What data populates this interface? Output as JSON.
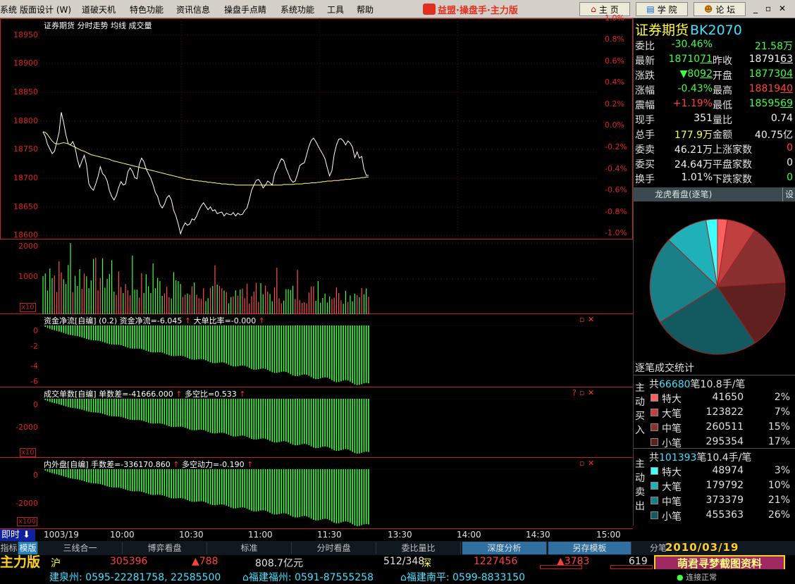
{
  "menu": {
    "items": [
      "系统",
      "版面设计 (W)",
      "道破天机",
      "特色功能",
      "资讯信息",
      "操盘手点睛",
      "系统功能",
      "工具",
      "帮助"
    ],
    "brand": "益盟·操盘手·主力版",
    "buttons": [
      "主 页",
      "学 院",
      "论 坛"
    ],
    "window_controls": [
      "_",
      "▫",
      "✕"
    ]
  },
  "price_chart": {
    "title": "证券期货  分时走势 均线 成交量",
    "left_ticks": [
      "18950",
      "18900",
      "18850",
      "18800",
      "18750",
      "18700",
      "18650",
      "18600"
    ],
    "right_ticks": [
      "1.0%",
      "0.8%",
      "0.6%",
      "0.4%",
      "0.2%",
      "0.0%",
      "-0.2%",
      "-0.4%",
      "-0.6%",
      "-0.8%",
      "-1.0%"
    ],
    "ylim": [
      18593,
      18979
    ],
    "prev_close": 18791.63,
    "price": [
      18781,
      18773,
      18759,
      18751,
      18743,
      18747,
      18763,
      18780,
      18815,
      18797,
      18776,
      18760,
      18758,
      18764,
      18754,
      18733,
      18719,
      18730,
      18740,
      18723,
      18690,
      18683,
      18679,
      18690,
      18703,
      18720,
      18708,
      18704,
      18695,
      18678,
      18668,
      18662,
      18670,
      18684,
      18694,
      18688,
      18690,
      18711,
      18718,
      18712,
      18701,
      18699,
      18724,
      18735,
      18729,
      18716,
      18708,
      18700,
      18689,
      18675,
      18668,
      18654,
      18648,
      18655,
      18666,
      18670,
      18662,
      18644,
      18634,
      18620,
      18603,
      18614,
      18622,
      18618,
      18620,
      18629,
      18627,
      18634,
      18644,
      18652,
      18657,
      18651,
      18645,
      18650,
      18643,
      18645,
      18638,
      18640,
      18641,
      18634,
      18639,
      18637,
      18636,
      18640,
      18634,
      18639,
      18636,
      18637,
      18644,
      18648,
      18663,
      18679,
      18688,
      18696,
      18698,
      18692,
      18683,
      18688,
      18695,
      18692,
      18688,
      18708,
      18716,
      18726,
      18734,
      18731,
      18718,
      18708,
      18698,
      18693,
      18695,
      18707,
      18722,
      18725,
      18727,
      18741,
      18756,
      18766,
      18770,
      18764,
      18756,
      18749,
      18742,
      18734,
      18718,
      18704,
      18713,
      18741,
      18758,
      18768,
      18769,
      18765,
      18758,
      18765,
      18761,
      18754,
      18736,
      18746,
      18735,
      18738,
      18716,
      18705,
      18705
    ],
    "avg": [
      18781,
      18780,
      18776,
      18770,
      18765,
      18761,
      18760,
      18760,
      18761,
      18762,
      18761,
      18760,
      18758,
      18756,
      18754,
      18752,
      18750,
      18748,
      18747,
      18745,
      18743,
      18741,
      18740,
      18739,
      18738,
      18737,
      18736,
      18735,
      18734,
      18733,
      18731,
      18730,
      18729,
      18728,
      18727,
      18726,
      18725,
      18724,
      18723,
      18722,
      18721,
      18720,
      18719,
      18718,
      18717,
      18716,
      18715,
      18714,
      18713,
      18712,
      18711,
      18710,
      18709,
      18708,
      18707,
      18706,
      18705,
      18704,
      18703,
      18702,
      18701,
      18700,
      18699,
      18698,
      18698,
      18697,
      18696,
      18696,
      18695,
      18695,
      18694,
      18694,
      18693,
      18693,
      18692,
      18692,
      18691,
      18691,
      18690,
      18690,
      18690,
      18689,
      18689,
      18689,
      18688,
      18688,
      18688,
      18688,
      18688,
      18688,
      18688,
      18688,
      18688,
      18688,
      18688,
      18688,
      18688,
      18688,
      18688,
      18688,
      18688,
      18688,
      18688,
      18688,
      18688,
      18689,
      18689,
      18689,
      18689,
      18689,
      18690,
      18690,
      18690,
      18690,
      18691,
      18691,
      18691,
      18692,
      18692,
      18692,
      18693,
      18693,
      18694,
      18694,
      18695,
      18695,
      18695,
      18696,
      18696,
      18696,
      18697,
      18697,
      18698,
      18698,
      18698,
      18699,
      18699,
      18700,
      18700,
      18701,
      18701,
      18702,
      18702
    ]
  },
  "volume": {
    "ticks": [
      "2000",
      "1000"
    ],
    "badge": "x10",
    "max": 2100
  },
  "money_flow": {
    "title_main": "资金净流[自编]",
    "title_param": "(0.2)",
    "title_val": "资金净流=-6.045",
    "title_ratio": "大单比率=-0.000",
    "ticks": [
      "0",
      "-2",
      "-4",
      "-6"
    ],
    "min": -6.3,
    "final": -6.045
  },
  "order_count": {
    "title_main": "成交单数[自编]",
    "title_val": "单数差=-41666.000",
    "title_ratio": "多空比=0.533",
    "ticks": [
      "0",
      "-2000"
    ],
    "badge": "x10",
    "min": -4500,
    "final": -4166.6
  },
  "inner_outer": {
    "title_main": "内外盘[自编]",
    "title_val": "手数差=-336170.860",
    "title_ratio": "多空动力=-0.190",
    "ticks": [
      "0",
      "-2000"
    ],
    "badge": "x100",
    "min": -3500,
    "final": -3361.7
  },
  "time_axis": {
    "labels": [
      "1003/19",
      "10:00",
      "10:30",
      "11:00",
      "11:30",
      "13:30",
      "14:00",
      "14:30",
      "15:00"
    ],
    "instant": "即时"
  },
  "side": {
    "title": "证券期货",
    "code": "BK2070",
    "rows": [
      {
        "l": "委比",
        "v": "-30.46%",
        "vc": "green",
        "l2": "",
        "v2": "21.58万",
        "v2c": "green"
      },
      {
        "l": "最新",
        "v": "18710",
        "vd": "71",
        "vc": "green",
        "l2": "昨收",
        "v2": "18791",
        "v2d": "63",
        "v2c": "white"
      },
      {
        "l": "涨跌",
        "v": "▼80",
        "vd": "92",
        "vc": "green",
        "l2": "开盘",
        "v2": "18773",
        "v2d": "04",
        "v2c": "green"
      },
      {
        "l": "涨幅",
        "v": "-0.43%",
        "vc": "green",
        "l2": "最高",
        "v2": "18819",
        "v2d": "40",
        "v2c": "red"
      },
      {
        "l": "震幅",
        "v": "+1.19%",
        "vc": "red",
        "l2": "最低",
        "v2": "18595",
        "v2d": "69",
        "v2c": "green"
      },
      {
        "l": "现手",
        "v": "351",
        "vc": "white",
        "l2": "量比",
        "v2": "0.74",
        "v2c": "white"
      },
      {
        "l": "总手",
        "v": "177.9万",
        "vc": "yel",
        "l2": "金额",
        "v2": "40.75亿",
        "v2c": "white"
      },
      {
        "l": "委卖",
        "v": "46.21万",
        "vc": "white",
        "l2": "上涨家数",
        "v2": "0",
        "v2c": "red"
      },
      {
        "l": "委买",
        "v": "24.64万",
        "vc": "white",
        "l2": "平盘家数",
        "v2": "0",
        "v2c": "white"
      },
      {
        "l": "换手",
        "v": "1.01%",
        "vc": "white",
        "l2": "下跌家数",
        "v2": "0",
        "v2c": "green"
      }
    ],
    "tab_label": "龙虎看盘(逐笔)",
    "tab_set": "设",
    "stats_title": "逐笔成交统计",
    "buy": {
      "label": "主动买入",
      "count": "66680",
      "count_prefix": "共",
      "count_suffix": "笔10.8手/笔",
      "rows": [
        {
          "n": "特大",
          "v": "41650",
          "p": "2%",
          "c": "#ff6060"
        },
        {
          "n": "大笔",
          "v": "123822",
          "p": "7%",
          "c": "#c04040"
        },
        {
          "n": "中笔",
          "v": "260511",
          "p": "15%",
          "c": "#8a3030"
        },
        {
          "n": "小笔",
          "v": "295354",
          "p": "17%",
          "c": "#602020"
        }
      ]
    },
    "sell": {
      "label": "主动卖出",
      "count": "101393",
      "count_prefix": "共",
      "count_suffix": "笔10.4手/笔",
      "rows": [
        {
          "n": "特大",
          "v": "48974",
          "p": "3%",
          "c": "#40ffff"
        },
        {
          "n": "大笔",
          "v": "179792",
          "p": "10%",
          "c": "#20b0b8"
        },
        {
          "n": "中笔",
          "v": "373379",
          "p": "21%",
          "c": "#1a8088"
        },
        {
          "n": "小笔",
          "v": "455363",
          "p": "26%",
          "c": "#135a60"
        }
      ]
    }
  },
  "bottom_tabs": [
    "指标",
    "模版",
    "三线合一",
    "博弈看盘",
    "标准",
    "分时看盘",
    "委比量比",
    "深度分析",
    "另存模板",
    "分笔"
  ],
  "date_watermark": "2010/03/19",
  "ticker": {
    "brand": "主力版",
    "sh_label": "沪",
    "sh_val": "305396",
    "sh_chg": "▲788",
    "amount": "808.7亿元",
    "ratio": "512/348",
    "sz_label": "深",
    "sz_val": "1227456",
    "sz_chg": "▲3783",
    "tail": "619"
  },
  "scroller": {
    "text1": "建泉州: 0595-22281758, 22585500",
    "text2": "福建福州: 0591-87555258",
    "text3": "福建南平: 0599-8833150",
    "status": "连接正常"
  },
  "stamp": "萌君寻梦截图资料"
}
